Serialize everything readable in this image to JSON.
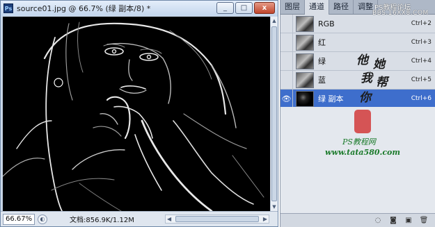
{
  "document": {
    "title": "source01.jpg @ 66.7% (绿 副本/8) *",
    "app_icon": "Ps",
    "window_buttons": {
      "minimize": "_",
      "maximize": "□",
      "close": "x"
    },
    "zoom": "66.67%",
    "doc_info": "文档:856.9K/1.12M"
  },
  "panel": {
    "tabs": [
      "图层",
      "通道",
      "路径",
      "调整"
    ],
    "active_tab": "通道",
    "channels": [
      {
        "name": "RGB",
        "shortcut": "Ctrl+2",
        "visible": false,
        "selected": false
      },
      {
        "name": "红",
        "shortcut": "Ctrl+3",
        "visible": false,
        "selected": false
      },
      {
        "name": "绿",
        "shortcut": "Ctrl+4",
        "visible": false,
        "selected": false
      },
      {
        "name": "蓝",
        "shortcut": "Ctrl+5",
        "visible": false,
        "selected": false
      },
      {
        "name": "绿 副本",
        "shortcut": "Ctrl+6",
        "visible": true,
        "selected": true
      }
    ],
    "bottom_icons": [
      "dotted-circle-icon",
      "mask-icon",
      "new-channel-icon",
      "trash-icon"
    ]
  },
  "watermark": {
    "top_line": "PS教程论坛",
    "top_url": "BBS.16XX8.COM",
    "calligraphy": [
      "他",
      "她",
      "我",
      "帮",
      "你"
    ],
    "site_name": "PS教程网",
    "site_url": "www.tata580.com"
  },
  "colors": {
    "selection_blue": "#3e6ecc",
    "seal_red": "#d23a3a",
    "site_green": "#1a7a2a"
  }
}
